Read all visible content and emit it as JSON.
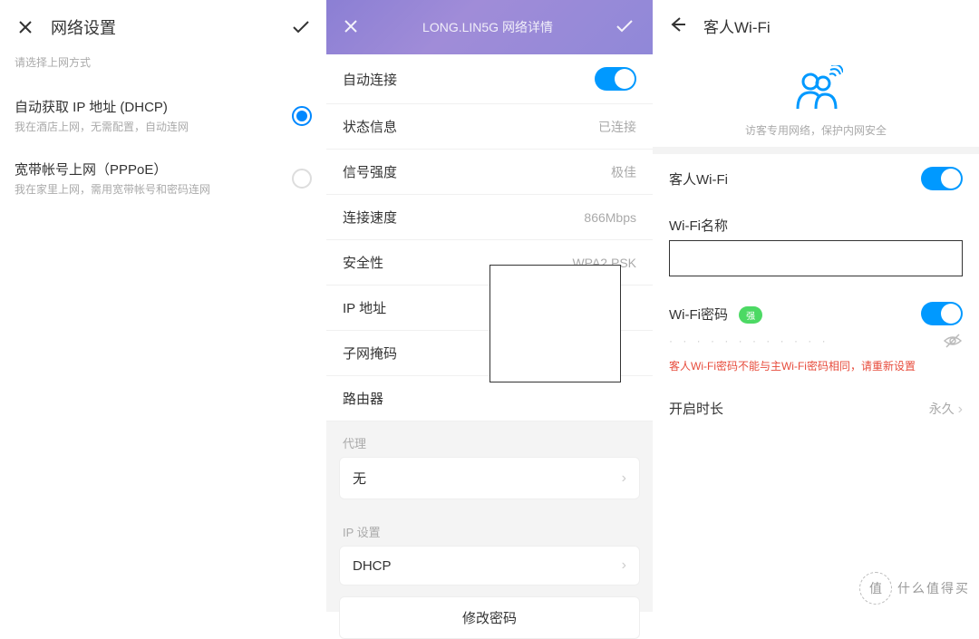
{
  "pane1": {
    "title": "网络设置",
    "subtitle": "请选择上网方式",
    "options": [
      {
        "title": "自动获取 IP 地址 (DHCP)",
        "desc": "我在酒店上网，无需配置，自动连网",
        "selected": true
      },
      {
        "title": "宽带帐号上网（PPPoE）",
        "desc": "我在家里上网，需用宽带帐号和密码连网",
        "selected": false
      }
    ]
  },
  "pane2": {
    "header_title": "LONG.LIN5G 网络详情",
    "rows": [
      {
        "label": "自动连接",
        "type": "toggle",
        "value": "on"
      },
      {
        "label": "状态信息",
        "value": "已连接"
      },
      {
        "label": "信号强度",
        "value": "极佳"
      },
      {
        "label": "连接速度",
        "value": "866Mbps"
      },
      {
        "label": "安全性",
        "value": "WPA2 PSK"
      },
      {
        "label": "IP 地址",
        "value": ""
      },
      {
        "label": "子网掩码",
        "value": ""
      },
      {
        "label": "路由器",
        "value": ""
      }
    ],
    "proxy_label": "代理",
    "proxy_value": "无",
    "ip_label": "IP 设置",
    "ip_value": "DHCP",
    "change_pwd": "修改密码"
  },
  "pane3": {
    "title": "客人Wi-Fi",
    "hero_text": "访客专用网络，保护内网安全",
    "guest_wifi_label": "客人Wi-Fi",
    "name_label": "Wi-Fi名称",
    "name_value": "",
    "pwd_label": "Wi-Fi密码",
    "pwd_badge": "强",
    "pwd_mask": "· · · · · · · · · · · ·",
    "error": "客人Wi-Fi密码不能与主Wi-Fi密码相同，请重新设置",
    "duration_label": "开启时长",
    "duration_value": "永久"
  },
  "watermark": {
    "circle": "值",
    "text": "什么值得买"
  }
}
